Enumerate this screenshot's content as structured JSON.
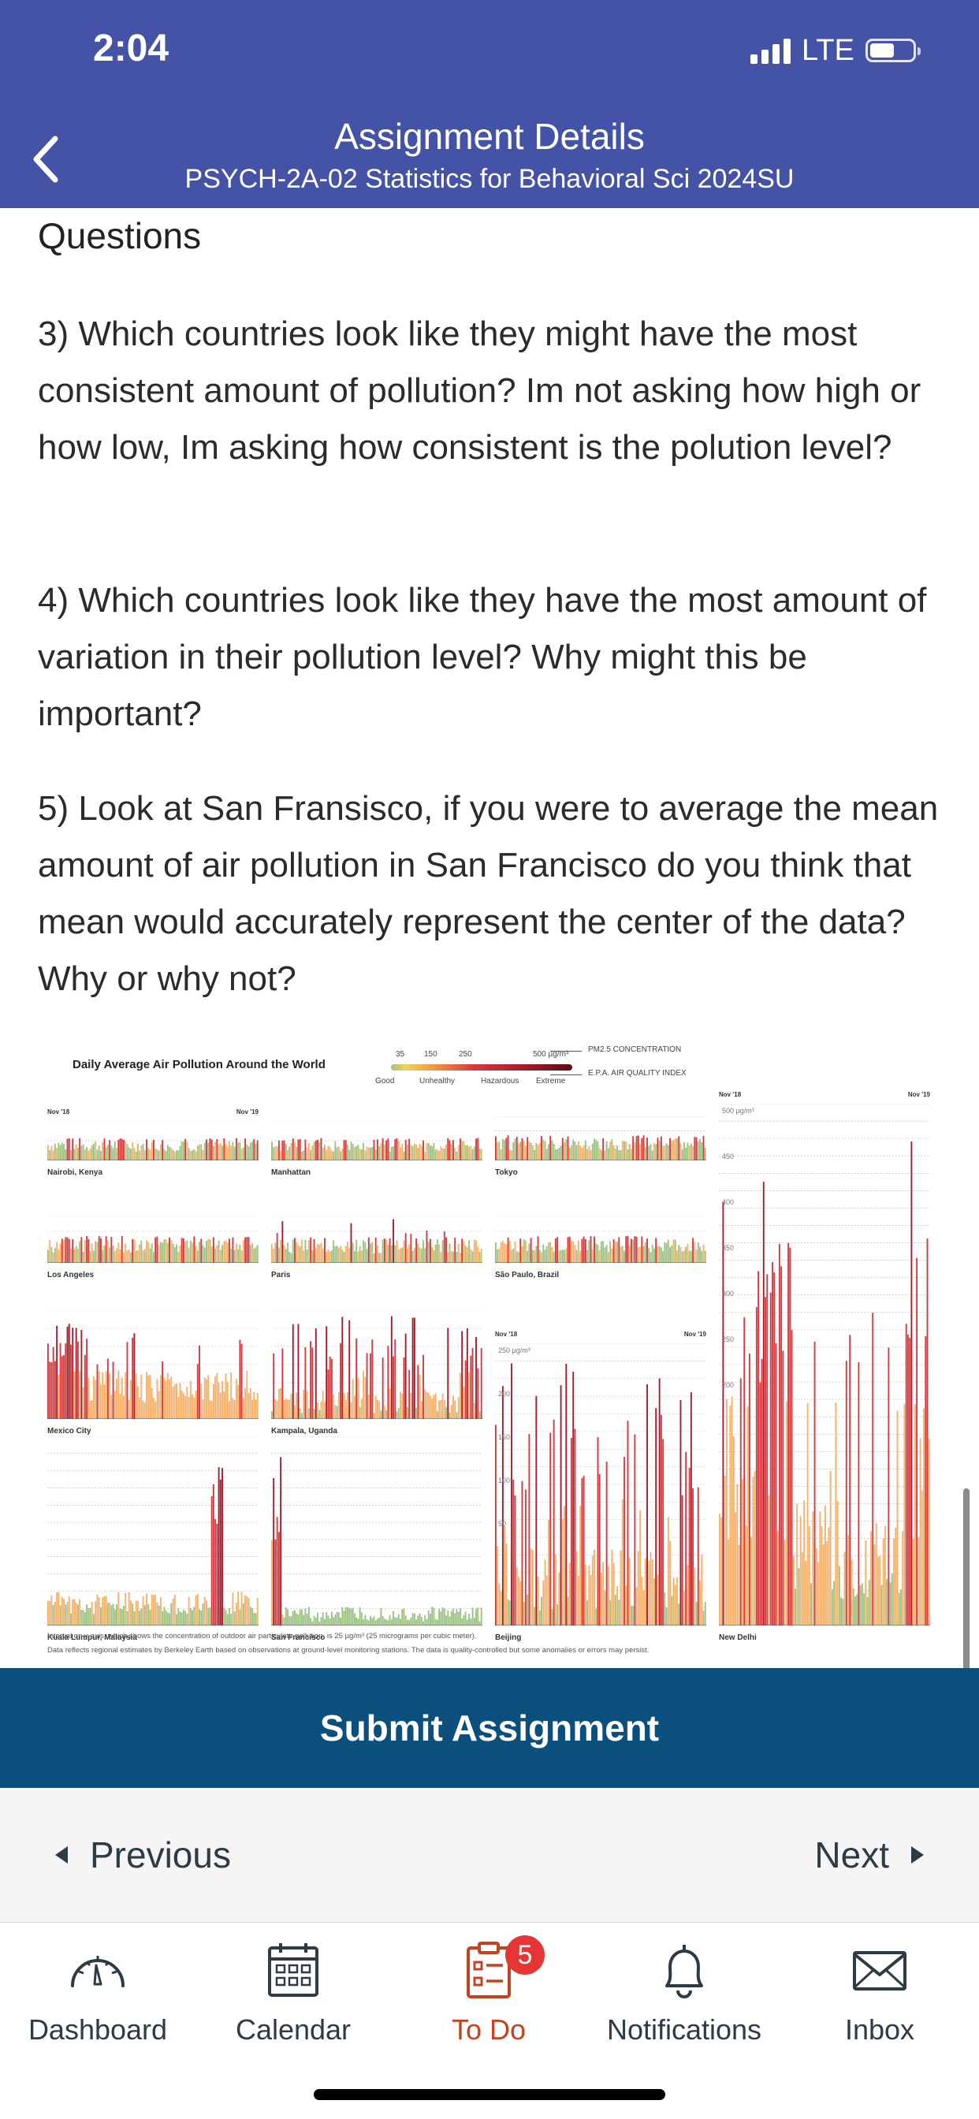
{
  "status_bar": {
    "time": "2:04",
    "network": "LTE",
    "signal_bars": 4,
    "battery_level": 0.55
  },
  "header": {
    "title": "Assignment Details",
    "subtitle": "PSYCH-2A-02 Statistics for Behavioral Sci 2024SU",
    "back_icon": "chevron-left-icon"
  },
  "content": {
    "section_heading": "Questions",
    "questions": [
      "3) Which countries look like they might have the most consistent amount of pollution?  Im not asking how high or how low, Im asking how consistent is the polution level?",
      "4) Which countries look like they have the most amount of variation in their pollution level?  Why might this be important?",
      "5) Look at San Fransisco, if you were to average the mean amount of air pollution in San Francisco do you think that mean would accurately represent the center of the data?  Why or why not?"
    ]
  },
  "figure": {
    "title": "Daily Average Air Pollution Around the World",
    "legend": {
      "ticks": [
        "35",
        "150",
        "250",
        "500 µg/m³"
      ],
      "categories": [
        "Good",
        "Unhealthy",
        "Hazardous",
        "Extreme"
      ],
      "keys": [
        "PM2.5 CONCENTRATION",
        "E.P.A. AIR QUALITY INDEX"
      ]
    },
    "date_start": "Nov '18",
    "date_end": "Nov '19",
    "notes": [
      "Interval on y-axis, which shows the concentration of outdoor air particulate pollution, is 25 µg/m³ (25 micrograms per cubic meter).",
      "Data reflects regional estimates by Berkeley Earth based on observations at ground-level monitoring stations. The data is quality-controlled but some anomalies or errors may persist."
    ],
    "colors": {
      "good": "#9dc383",
      "moderate": "#f6b26b",
      "unhealthy": "#e06656",
      "hazardous": "#d93a3f",
      "extreme": "#a81d2c"
    }
  },
  "chart_data": [
    {
      "type": "bar",
      "name": "Nairobi, Kenya",
      "pattern": "low-steady",
      "ylim": [
        0,
        75
      ]
    },
    {
      "type": "bar",
      "name": "Manhattan",
      "pattern": "low-steady",
      "ylim": [
        0,
        75
      ]
    },
    {
      "type": "bar",
      "name": "Tokyo",
      "pattern": "low-steady",
      "ylim": [
        0,
        75
      ]
    },
    {
      "type": "bar",
      "name": "Los Angeles",
      "pattern": "low-steady",
      "ylim": [
        0,
        75
      ]
    },
    {
      "type": "bar",
      "name": "Paris",
      "pattern": "low-spiky",
      "ylim": [
        0,
        75
      ]
    },
    {
      "type": "bar",
      "name": "São Paulo, Brazil",
      "pattern": "low-steady",
      "ylim": [
        0,
        75
      ]
    },
    {
      "type": "bar",
      "name": "Mexico City",
      "pattern": "moderate-variable",
      "ylim": [
        0,
        100
      ]
    },
    {
      "type": "bar",
      "name": "Kampala, Uganda",
      "pattern": "high-variable",
      "ylim": [
        0,
        100
      ]
    },
    {
      "type": "bar",
      "name": "Kuala Lumpur, Malaysia",
      "pattern": "low-with-late-spike",
      "ylim": [
        0,
        125
      ]
    },
    {
      "type": "bar",
      "name": "San Francisco",
      "pattern": "low-with-early-spike",
      "ylim": [
        0,
        125
      ]
    },
    {
      "type": "bar",
      "name": "Beijing",
      "pattern": "high-variable",
      "ylim": [
        0,
        250
      ],
      "yticks": [
        "250 µg/m³",
        "200",
        "150",
        "100",
        "50"
      ]
    },
    {
      "type": "bar",
      "name": "New Delhi",
      "pattern": "extreme-variable",
      "ylim": [
        0,
        500
      ],
      "yticks": [
        "500 µg/m³",
        "450",
        "400",
        "350",
        "300",
        "250",
        "200"
      ]
    }
  ],
  "actions": {
    "submit_label": "Submit Assignment",
    "previous_label": "Previous",
    "next_label": "Next"
  },
  "tab_bar": {
    "items": [
      {
        "label": "Dashboard",
        "icon": "dashboard-gauge-icon"
      },
      {
        "label": "Calendar",
        "icon": "calendar-icon"
      },
      {
        "label": "To Do",
        "icon": "todo-clipboard-icon",
        "badge": "5",
        "active": true
      },
      {
        "label": "Notifications",
        "icon": "bell-icon"
      },
      {
        "label": "Inbox",
        "icon": "envelope-icon"
      }
    ]
  }
}
